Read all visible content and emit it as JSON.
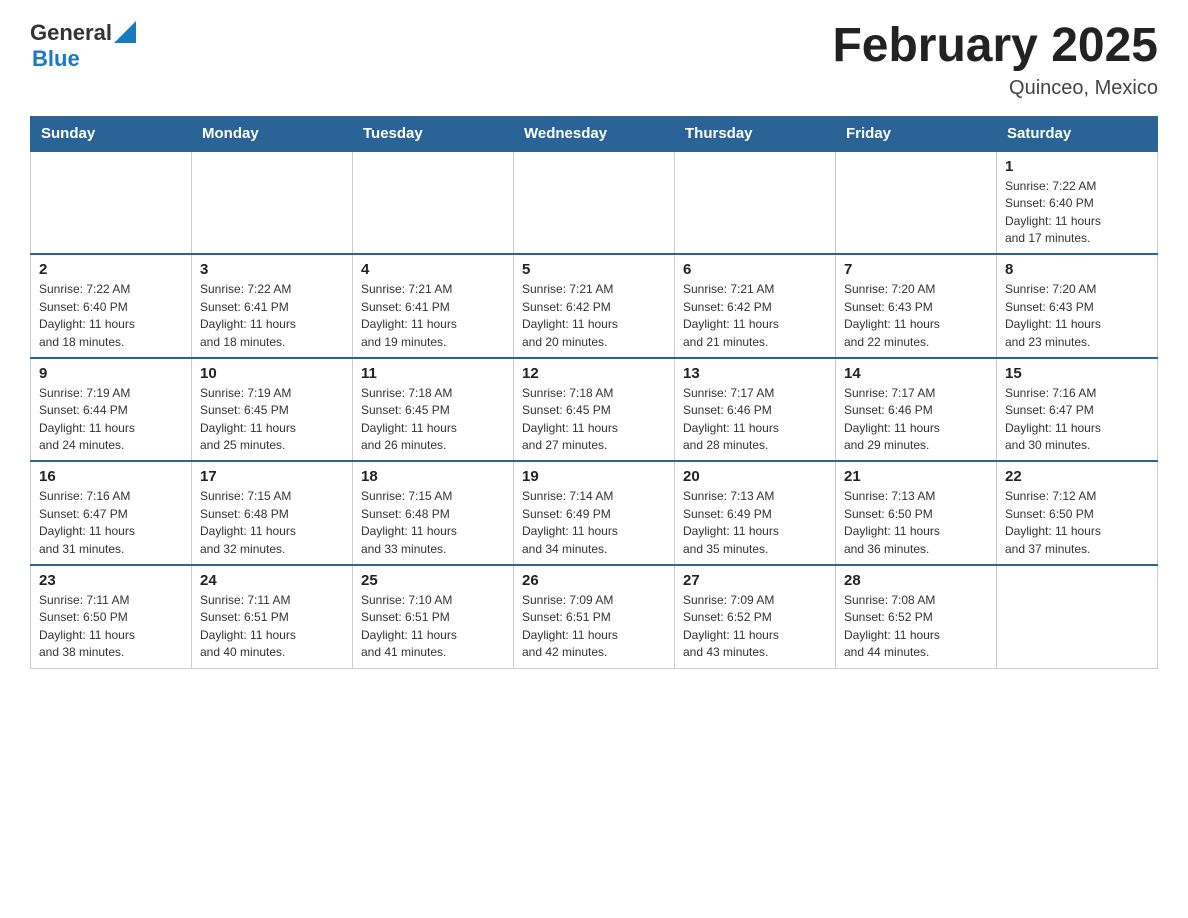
{
  "header": {
    "title": "February 2025",
    "location": "Quinceo, Mexico",
    "logo_general": "General",
    "logo_blue": "Blue"
  },
  "weekdays": [
    "Sunday",
    "Monday",
    "Tuesday",
    "Wednesday",
    "Thursday",
    "Friday",
    "Saturday"
  ],
  "weeks": [
    [
      {
        "day": "",
        "info": ""
      },
      {
        "day": "",
        "info": ""
      },
      {
        "day": "",
        "info": ""
      },
      {
        "day": "",
        "info": ""
      },
      {
        "day": "",
        "info": ""
      },
      {
        "day": "",
        "info": ""
      },
      {
        "day": "1",
        "info": "Sunrise: 7:22 AM\nSunset: 6:40 PM\nDaylight: 11 hours\nand 17 minutes."
      }
    ],
    [
      {
        "day": "2",
        "info": "Sunrise: 7:22 AM\nSunset: 6:40 PM\nDaylight: 11 hours\nand 18 minutes."
      },
      {
        "day": "3",
        "info": "Sunrise: 7:22 AM\nSunset: 6:41 PM\nDaylight: 11 hours\nand 18 minutes."
      },
      {
        "day": "4",
        "info": "Sunrise: 7:21 AM\nSunset: 6:41 PM\nDaylight: 11 hours\nand 19 minutes."
      },
      {
        "day": "5",
        "info": "Sunrise: 7:21 AM\nSunset: 6:42 PM\nDaylight: 11 hours\nand 20 minutes."
      },
      {
        "day": "6",
        "info": "Sunrise: 7:21 AM\nSunset: 6:42 PM\nDaylight: 11 hours\nand 21 minutes."
      },
      {
        "day": "7",
        "info": "Sunrise: 7:20 AM\nSunset: 6:43 PM\nDaylight: 11 hours\nand 22 minutes."
      },
      {
        "day": "8",
        "info": "Sunrise: 7:20 AM\nSunset: 6:43 PM\nDaylight: 11 hours\nand 23 minutes."
      }
    ],
    [
      {
        "day": "9",
        "info": "Sunrise: 7:19 AM\nSunset: 6:44 PM\nDaylight: 11 hours\nand 24 minutes."
      },
      {
        "day": "10",
        "info": "Sunrise: 7:19 AM\nSunset: 6:45 PM\nDaylight: 11 hours\nand 25 minutes."
      },
      {
        "day": "11",
        "info": "Sunrise: 7:18 AM\nSunset: 6:45 PM\nDaylight: 11 hours\nand 26 minutes."
      },
      {
        "day": "12",
        "info": "Sunrise: 7:18 AM\nSunset: 6:45 PM\nDaylight: 11 hours\nand 27 minutes."
      },
      {
        "day": "13",
        "info": "Sunrise: 7:17 AM\nSunset: 6:46 PM\nDaylight: 11 hours\nand 28 minutes."
      },
      {
        "day": "14",
        "info": "Sunrise: 7:17 AM\nSunset: 6:46 PM\nDaylight: 11 hours\nand 29 minutes."
      },
      {
        "day": "15",
        "info": "Sunrise: 7:16 AM\nSunset: 6:47 PM\nDaylight: 11 hours\nand 30 minutes."
      }
    ],
    [
      {
        "day": "16",
        "info": "Sunrise: 7:16 AM\nSunset: 6:47 PM\nDaylight: 11 hours\nand 31 minutes."
      },
      {
        "day": "17",
        "info": "Sunrise: 7:15 AM\nSunset: 6:48 PM\nDaylight: 11 hours\nand 32 minutes."
      },
      {
        "day": "18",
        "info": "Sunrise: 7:15 AM\nSunset: 6:48 PM\nDaylight: 11 hours\nand 33 minutes."
      },
      {
        "day": "19",
        "info": "Sunrise: 7:14 AM\nSunset: 6:49 PM\nDaylight: 11 hours\nand 34 minutes."
      },
      {
        "day": "20",
        "info": "Sunrise: 7:13 AM\nSunset: 6:49 PM\nDaylight: 11 hours\nand 35 minutes."
      },
      {
        "day": "21",
        "info": "Sunrise: 7:13 AM\nSunset: 6:50 PM\nDaylight: 11 hours\nand 36 minutes."
      },
      {
        "day": "22",
        "info": "Sunrise: 7:12 AM\nSunset: 6:50 PM\nDaylight: 11 hours\nand 37 minutes."
      }
    ],
    [
      {
        "day": "23",
        "info": "Sunrise: 7:11 AM\nSunset: 6:50 PM\nDaylight: 11 hours\nand 38 minutes."
      },
      {
        "day": "24",
        "info": "Sunrise: 7:11 AM\nSunset: 6:51 PM\nDaylight: 11 hours\nand 40 minutes."
      },
      {
        "day": "25",
        "info": "Sunrise: 7:10 AM\nSunset: 6:51 PM\nDaylight: 11 hours\nand 41 minutes."
      },
      {
        "day": "26",
        "info": "Sunrise: 7:09 AM\nSunset: 6:51 PM\nDaylight: 11 hours\nand 42 minutes."
      },
      {
        "day": "27",
        "info": "Sunrise: 7:09 AM\nSunset: 6:52 PM\nDaylight: 11 hours\nand 43 minutes."
      },
      {
        "day": "28",
        "info": "Sunrise: 7:08 AM\nSunset: 6:52 PM\nDaylight: 11 hours\nand 44 minutes."
      },
      {
        "day": "",
        "info": ""
      }
    ]
  ]
}
